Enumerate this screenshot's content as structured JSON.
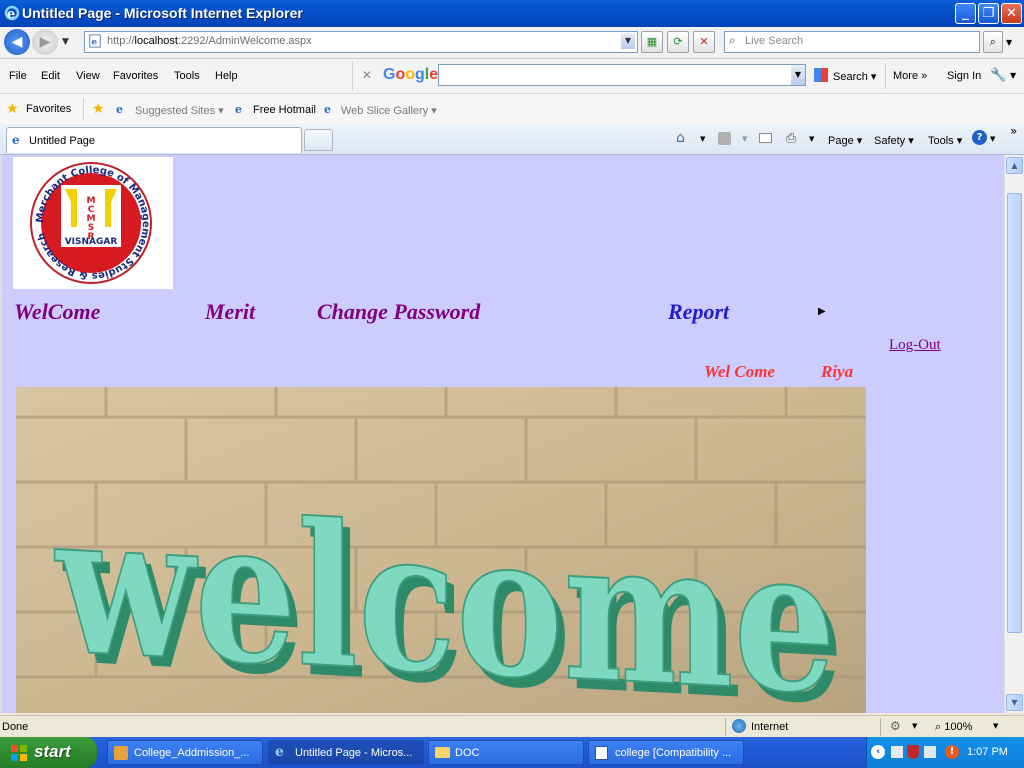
{
  "window": {
    "title": "Untitled Page - Microsoft Internet Explorer",
    "minimize": "_",
    "maximize": "❐",
    "close": "✕"
  },
  "address": {
    "url_prefix": "http://",
    "url_host": "localhost",
    "url_rest": ":2292/AdminWelcome.aspx",
    "live_search_placeholder": "Live Search"
  },
  "menu": {
    "items": [
      "File",
      "Edit",
      "View",
      "Favorites",
      "Tools",
      "Help"
    ],
    "google_logo": "Google",
    "google_search": "Search",
    "more": "More",
    "sign_in": "Sign In"
  },
  "favorites": {
    "label": "Favorites",
    "links": [
      "Suggested Sites",
      "Free Hotmail",
      "Web Slice Gallery"
    ]
  },
  "tabs": {
    "active_tab": "Untitled Page",
    "commands": [
      "Page",
      "Safety",
      "Tools"
    ]
  },
  "page": {
    "logo": {
      "ring_text": "Merchant College of Management Studies & Research",
      "abbr": "MCMSR",
      "place": "VISNAGAR"
    },
    "nav": [
      "WelCome",
      "Merit",
      "Change Password",
      "Report"
    ],
    "logout": "Log-Out",
    "welcome_label": "Wel Come",
    "user_name": "Riya",
    "banner_text": "welcome"
  },
  "status": {
    "text": "Done",
    "zone": "Internet",
    "zoom": "100%"
  },
  "taskbar": {
    "start": "start",
    "tasks": [
      "College_Addmission_...",
      "Untitled Page - Micros...",
      "DOC",
      "college [Compatibility ..."
    ],
    "clock": "1:07 PM"
  },
  "colors": {
    "page_bg": "#ccccff",
    "nav_purple": "#800080",
    "nav_blue": "#1e1ecc",
    "welcome_red": "#ff3333",
    "logo_red": "#d71920",
    "banner_green": "#6fd3b8"
  }
}
